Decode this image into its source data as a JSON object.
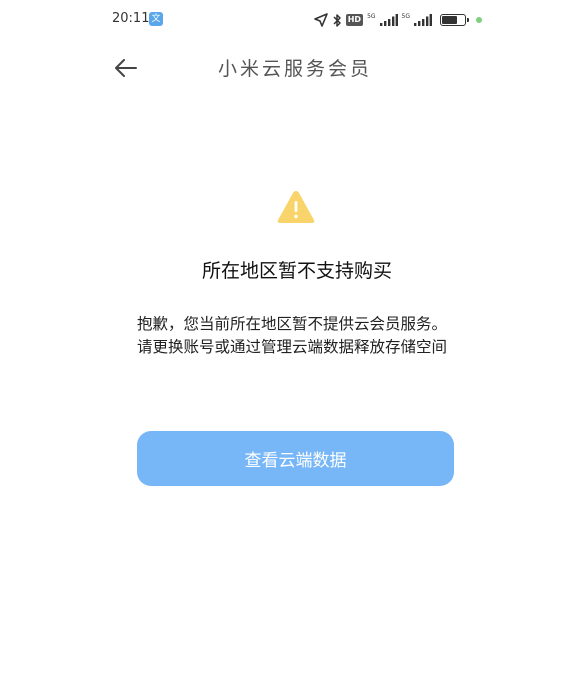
{
  "status_bar": {
    "time": "20:11",
    "app_badge": "文",
    "hd": "HD",
    "network_1": "5G",
    "network_2": "5G",
    "battery_level": 0.8
  },
  "header": {
    "title": "小米云服务会员",
    "back_icon": "arrow-left-icon"
  },
  "content": {
    "icon": "warning-triangle-icon",
    "icon_color": "#f8d46a",
    "heading": "所在地区暂不支持购买",
    "message": "抱歉，您当前所在地区暂不提供云会员服务。请更换账号或通过管理云端数据释放存储空间"
  },
  "action": {
    "label": "查看云端数据",
    "color": "#78b7f7"
  }
}
